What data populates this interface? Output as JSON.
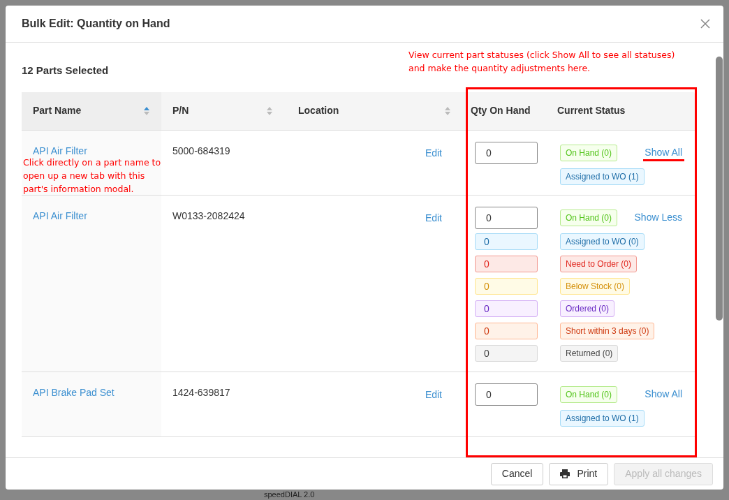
{
  "background_text": "speedDIAL 2.0",
  "modal": {
    "title": "Bulk Edit: Quantity on Hand",
    "subtitle": "12 Parts Selected"
  },
  "columns": [
    {
      "label": "Part Name",
      "sorted": true
    },
    {
      "label": "P/N",
      "sorted": false
    },
    {
      "label": "Location",
      "sorted": false
    },
    {
      "label": "Qty On Hand"
    },
    {
      "label": "Current Status"
    }
  ],
  "rows": [
    {
      "name": "API Air Filter",
      "pn": "5000-684319",
      "action": "Edit",
      "qty": "0",
      "toggle": "Show All",
      "statuses": [
        {
          "label": "On Hand (0)",
          "kind": "on_hand"
        },
        {
          "label": "Assigned to WO (1)",
          "kind": "assigned"
        }
      ]
    },
    {
      "name": "API Air Filter",
      "pn": "W0133-2082424",
      "action": "Edit",
      "qty": "0",
      "toggle": "Show Less",
      "statuses": [
        {
          "label": "On Hand (0)",
          "kind": "on_hand"
        },
        {
          "label": "Assigned to WO (0)",
          "kind": "assigned",
          "qty": "0"
        },
        {
          "label": "Need to Order (0)",
          "kind": "need",
          "qty": "0"
        },
        {
          "label": "Below Stock (0)",
          "kind": "below",
          "qty": "0"
        },
        {
          "label": "Ordered (0)",
          "kind": "ordered",
          "qty": "0"
        },
        {
          "label": "Short within 3 days (0)",
          "kind": "short",
          "qty": "0"
        },
        {
          "label": "Returned (0)",
          "kind": "returned",
          "qty": "0"
        }
      ]
    },
    {
      "name": "API Brake Pad Set",
      "pn": "1424-639817",
      "action": "Edit",
      "qty": "0",
      "toggle": "Show All",
      "statuses": [
        {
          "label": "On Hand (0)",
          "kind": "on_hand"
        },
        {
          "label": "Assigned to WO (1)",
          "kind": "assigned"
        }
      ]
    }
  ],
  "annotations": [
    {
      "text": "View current part statuses (click Show All to see all statuses) and make the quantity adjustments here.",
      "kind": "top"
    },
    {
      "text": "Click directly on a part name to open up a new tab with this part's information modal.",
      "kind": "left"
    }
  ],
  "footer": {
    "buttons": [
      {
        "label": "Cancel",
        "kind": "plain",
        "disabled": false
      },
      {
        "label": "Print",
        "kind": "print",
        "disabled": false
      },
      {
        "label": "Apply all changes",
        "kind": "plain",
        "disabled": true
      }
    ]
  }
}
